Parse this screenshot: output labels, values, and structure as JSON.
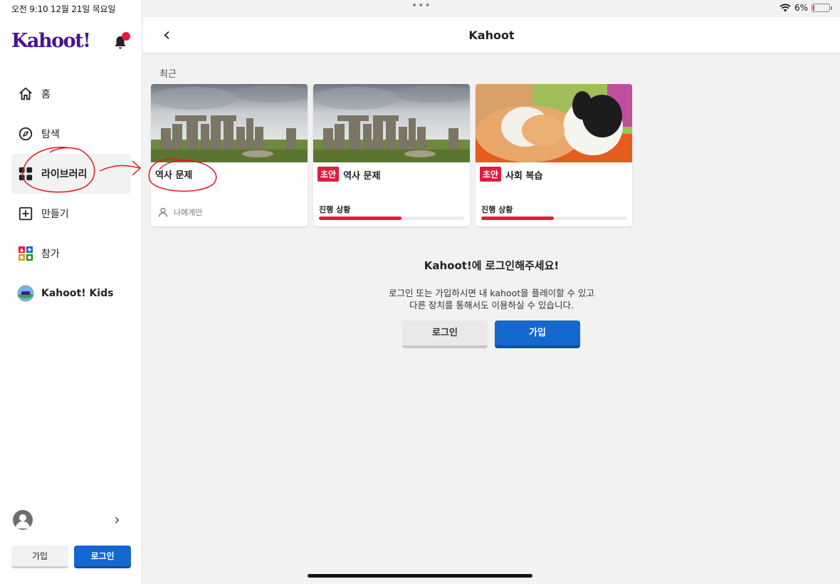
{
  "status_bar": {
    "time": "오전 9:10   12월 21일 목요일",
    "battery": "6%",
    "battery_level": 0.06
  },
  "sidebar": {
    "logo": "Kahoot!",
    "items": [
      {
        "label": "홈",
        "icon": "home-icon"
      },
      {
        "label": "탐색",
        "icon": "compass-icon"
      },
      {
        "label": "라이브러리",
        "icon": "library-icon",
        "active": true
      },
      {
        "label": "만들기",
        "icon": "plus-square-icon"
      },
      {
        "label": "참가",
        "icon": "join-icon"
      },
      {
        "label": "Kahoot! Kids",
        "icon": "kids-icon"
      }
    ],
    "signup_label": "가입",
    "login_label": "로그인"
  },
  "topbar": {
    "title": "Kahoot"
  },
  "section": {
    "label": "최근"
  },
  "cards": [
    {
      "title": "역사 문제",
      "owner": "나에게만",
      "image": "stonehenge"
    },
    {
      "badge": "초안",
      "title": "역사 문제",
      "progress_label": "진행 상황",
      "progress": 0.57,
      "image": "stonehenge"
    },
    {
      "badge": "초안",
      "title": "사회 복습",
      "progress_label": "진행 상황",
      "progress": 0.5,
      "image": "cats"
    }
  ],
  "login_prompt": {
    "title": "Kahoot!에 로그인해주세요!",
    "description": "로그인 또는 가입하시면 내 kahoot을 플레이할 수 있고 다른 장치를 통해서도 이용하실 수 있습니다.",
    "login_label": "로그인",
    "signup_label": "가입"
  },
  "colors": {
    "brand": "#46178f",
    "accent_blue": "#1368ce",
    "accent_red": "#e21b3c"
  }
}
